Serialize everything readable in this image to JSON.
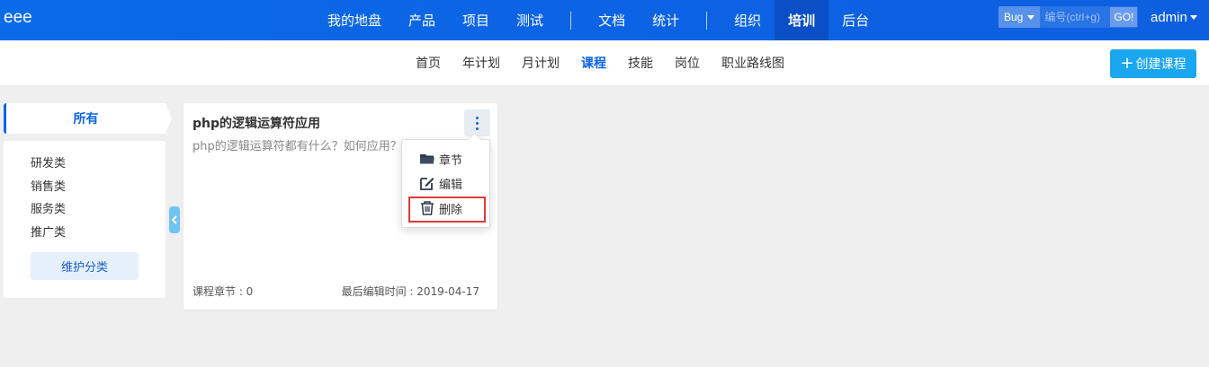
{
  "brand": "eee",
  "nav": {
    "items": [
      {
        "label": "我的地盘"
      },
      {
        "label": "产品"
      },
      {
        "label": "项目"
      },
      {
        "label": "测试"
      },
      {
        "label": "文档"
      },
      {
        "label": "统计"
      },
      {
        "label": "组织"
      },
      {
        "label": "培训",
        "active": true
      },
      {
        "label": "后台"
      }
    ]
  },
  "search": {
    "type": "Bug",
    "placeholder": "编号(ctrl+g)",
    "go_label": "GO!"
  },
  "user": {
    "name": "admin"
  },
  "subnav": {
    "items": [
      {
        "label": "首页"
      },
      {
        "label": "年计划"
      },
      {
        "label": "月计划"
      },
      {
        "label": "课程",
        "active": true
      },
      {
        "label": "技能"
      },
      {
        "label": "岗位"
      },
      {
        "label": "职业路线图"
      }
    ],
    "create_label": "创建课程"
  },
  "sidebar": {
    "all_label": "所有",
    "categories": [
      "研发类",
      "销售类",
      "服务类",
      "推广类"
    ],
    "maintain_label": "维护分类"
  },
  "course": {
    "title": "php的逻辑运算符应用",
    "description": "php的逻辑运算符都有什么？如何应用？请阐述。",
    "chapters": "课程章节 : 0",
    "last_edit": "最后编辑时间 : 2019-04-17"
  },
  "menu": {
    "chapter": "章节",
    "edit": "编辑",
    "delete": "删除"
  },
  "colors": {
    "primary": "#0c64eb",
    "accent": "#1ba6f0",
    "highlight": "#e23a3a"
  }
}
